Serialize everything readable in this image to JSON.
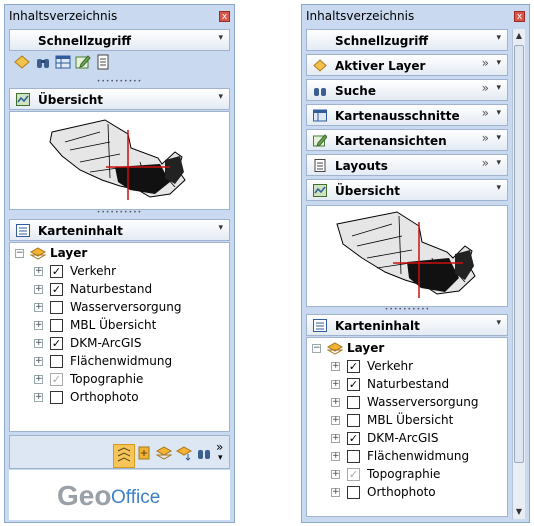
{
  "left_panel": {
    "title": "Inhaltsverzeichnis",
    "close_glyph": "x",
    "quick_access": "Schnellzugriff",
    "overview": "Übersicht",
    "map_content": "Karteninhalt",
    "tree": {
      "root": "Layer",
      "items": [
        {
          "label": "Verkehr",
          "checked": true,
          "disabled": false
        },
        {
          "label": "Naturbestand",
          "checked": true,
          "disabled": false
        },
        {
          "label": "Wasserversorgung",
          "checked": false,
          "disabled": false
        },
        {
          "label": "MBL Übersicht",
          "checked": false,
          "disabled": false
        },
        {
          "label": "DKM-ArcGIS",
          "checked": true,
          "disabled": false
        },
        {
          "label": "Flächenwidmung",
          "checked": false,
          "disabled": false
        },
        {
          "label": "Topographie",
          "checked": true,
          "disabled": true
        },
        {
          "label": "Orthophoto",
          "checked": false,
          "disabled": false
        }
      ]
    },
    "logo": {
      "geo": "Geo",
      "office": "Office"
    }
  },
  "right_panel": {
    "title": "Inhaltsverzeichnis",
    "close_glyph": "x",
    "sections": [
      {
        "label": "Schnellzugriff",
        "icon": "none",
        "more": ""
      },
      {
        "label": "Aktiver Layer",
        "icon": "diamond-icon",
        "more": "»"
      },
      {
        "label": "Suche",
        "icon": "binoculars-icon",
        "more": "»"
      },
      {
        "label": "Kartenausschnitte",
        "icon": "map-table-icon",
        "more": "»"
      },
      {
        "label": "Kartenansichten",
        "icon": "map-edit-icon",
        "more": "»"
      },
      {
        "label": "Layouts",
        "icon": "page-icon",
        "more": "»"
      },
      {
        "label": "Übersicht",
        "icon": "overview-icon",
        "more": ""
      }
    ],
    "map_content": "Karteninhalt",
    "tree": {
      "root": "Layer",
      "items": [
        {
          "label": "Verkehr",
          "checked": true,
          "disabled": false
        },
        {
          "label": "Naturbestand",
          "checked": true,
          "disabled": false
        },
        {
          "label": "Wasserversorgung",
          "checked": false,
          "disabled": false
        },
        {
          "label": "MBL Übersicht",
          "checked": false,
          "disabled": false
        },
        {
          "label": "DKM-ArcGIS",
          "checked": true,
          "disabled": false
        },
        {
          "label": "Flächenwidmung",
          "checked": false,
          "disabled": false
        },
        {
          "label": "Topographie",
          "checked": true,
          "disabled": true
        },
        {
          "label": "Orthophoto",
          "checked": false,
          "disabled": false
        }
      ]
    }
  },
  "glyphs": {
    "dropdown": "▾",
    "more": "»",
    "expand": "+",
    "collapse": "−",
    "check": "✓"
  },
  "colors": {
    "panel_bg": "#c9d9ef",
    "accent_orange": "#f2b233",
    "logo_gray": "#9aa0a8",
    "logo_blue": "#3d7fc8",
    "crosshair_red": "#cc1111"
  }
}
